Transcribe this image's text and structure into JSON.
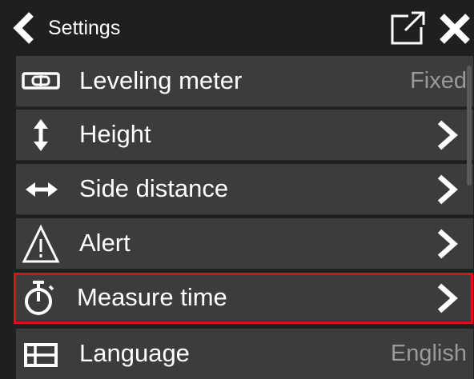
{
  "header": {
    "title": "Settings"
  },
  "rows": [
    {
      "label": "Leveling meter",
      "value": "Fixed",
      "icon": "leveling-meter-icon"
    },
    {
      "label": "Height",
      "icon": "vertical-arrows-icon"
    },
    {
      "label": "Side distance",
      "icon": "horizontal-arrows-icon"
    },
    {
      "label": "Alert",
      "icon": "warning-icon"
    },
    {
      "label": "Measure time",
      "icon": "stopwatch-icon",
      "highlighted": true
    },
    {
      "label": "Language",
      "value": "English",
      "icon": "language-icon"
    }
  ],
  "colors": {
    "background": "#1f1f1f",
    "row": "#3c3c3c",
    "highlight_border": "#e0101b",
    "value_text": "#9a9a9a"
  }
}
